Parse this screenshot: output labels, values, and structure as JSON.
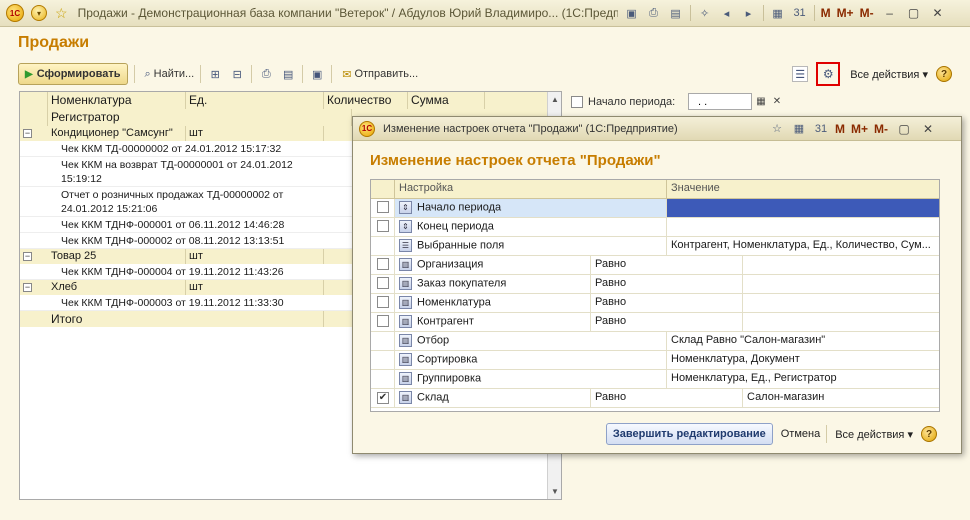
{
  "window": {
    "title": "Продажи - Демонстрационная база компании \"Ветерок\" / Абдулов Юрий Владимиро... (1С:Предприятие)",
    "logo_text": "1С",
    "m_buttons": [
      "M",
      "M+",
      "M-"
    ]
  },
  "page": {
    "title": "Продажи"
  },
  "toolbar": {
    "run_label": "Сформировать",
    "find_label": "Найти...",
    "send_label": "Отправить...",
    "all_actions": "Все действия",
    "help": "?"
  },
  "report": {
    "columns": [
      "Номенклатура",
      "Ед.",
      "Количество",
      "Сумма"
    ],
    "registrar_header": "Регистратор",
    "groups": [
      {
        "name": "Кондиционер \"Самсунг\"",
        "unit": "шт",
        "rows": [
          {
            "lines": [
              "Чек ККМ ТД-00000002 от 24.01.2012 15:17:32"
            ]
          },
          {
            "lines": [
              "Чек ККМ на возврат ТД-00000001 от 24.01.2012",
              "15:19:12"
            ]
          },
          {
            "lines": [
              "Отчет о розничных продажах ТД-00000002 от",
              "24.01.2012 15:21:06"
            ]
          },
          {
            "lines": [
              "Чек ККМ ТДНФ-000001 от 06.11.2012 14:46:28"
            ]
          },
          {
            "lines": [
              "Чек ККМ ТДНФ-000002 от 08.11.2012 13:13:51"
            ]
          }
        ]
      },
      {
        "name": "Товар 25",
        "unit": "шт",
        "rows": [
          {
            "lines": [
              "Чек ККМ ТДНФ-000004 от 19.11.2012 11:43:26"
            ]
          }
        ]
      },
      {
        "name": "Хлеб",
        "unit": "шт",
        "rows": [
          {
            "lines": [
              "Чек ККМ ТДНФ-000003 от 19.11.2012 11:33:30"
            ]
          }
        ]
      }
    ],
    "total_label": "Итого"
  },
  "period": {
    "label": "Начало периода:",
    "value": " . .",
    "checked": false
  },
  "dialog": {
    "title": "Изменение настроек отчета \"Продажи\"  (1С:Предприятие)",
    "heading": "Изменение настроек отчета \"Продажи\"",
    "columns": {
      "setting": "Настройка",
      "value": "Значение"
    },
    "rows": [
      {
        "check": "off",
        "name": "Начало периода",
        "cond": "",
        "value": "",
        "selected": true,
        "span": true
      },
      {
        "check": "off",
        "name": "Конец периода",
        "cond": "",
        "value": "",
        "span": true
      },
      {
        "check": "none",
        "name": "Выбранные поля",
        "cond": "",
        "value": "Контрагент, Номенклатура, Ед., Количество, Сум...",
        "span": true
      },
      {
        "check": "off",
        "name": "Организация",
        "cond": "Равно",
        "value": ""
      },
      {
        "check": "off",
        "name": "Заказ покупателя",
        "cond": "Равно",
        "value": ""
      },
      {
        "check": "off",
        "name": "Номенклатура",
        "cond": "Равно",
        "value": ""
      },
      {
        "check": "off",
        "name": "Контрагент",
        "cond": "Равно",
        "value": ""
      },
      {
        "check": "none",
        "name": "Отбор",
        "cond": "",
        "value": "Склад Равно \"Салон-магазин\"",
        "span": true
      },
      {
        "check": "none",
        "name": "Сортировка",
        "cond": "",
        "value": "Номенклатура, Документ",
        "span": true
      },
      {
        "check": "none",
        "name": "Группировка",
        "cond": "",
        "value": "Номенклатура, Ед., Регистратор",
        "span": true
      },
      {
        "check": "on",
        "name": "Склад",
        "cond": "Равно",
        "value": "Салон-магазин"
      }
    ],
    "finish_label": "Завершить редактирование",
    "cancel_label": "Отмена",
    "all_actions": "Все действия",
    "help": "?"
  }
}
